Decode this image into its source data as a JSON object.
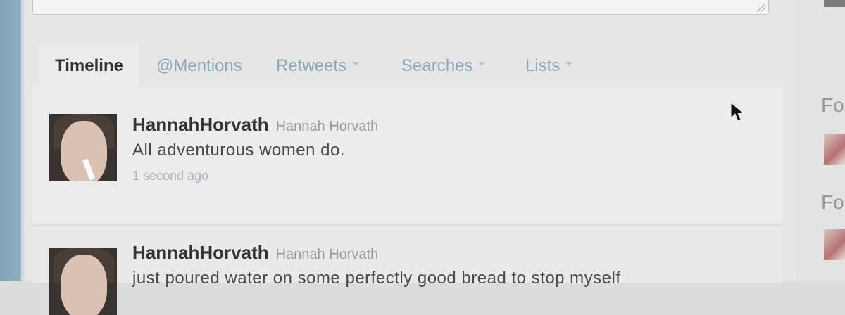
{
  "tabs": [
    {
      "label": "Timeline",
      "active": true
    },
    {
      "label": "@Mentions",
      "active": false
    },
    {
      "label": "Retweets",
      "active": false,
      "has_dropdown": true
    },
    {
      "label": "Searches",
      "active": false,
      "has_dropdown": true
    },
    {
      "label": "Lists",
      "active": false,
      "has_dropdown": true
    }
  ],
  "tweets": [
    {
      "screen_name": "HannahHorvath",
      "full_name": "Hannah Horvath",
      "text": "All adventurous women do.",
      "timestamp": "1 second ago"
    },
    {
      "screen_name": "HannahHorvath",
      "full_name": "Hannah Horvath",
      "text": "just poured water on some perfectly good bread to stop myself"
    }
  ],
  "sidebar": {
    "heading_1": "Fo",
    "heading_2": "Fo"
  },
  "colors": {
    "tab_link": "#8aa8b8",
    "tab_active": "#333333",
    "screen_name": "#333333",
    "timestamp": "#aab4bb"
  }
}
